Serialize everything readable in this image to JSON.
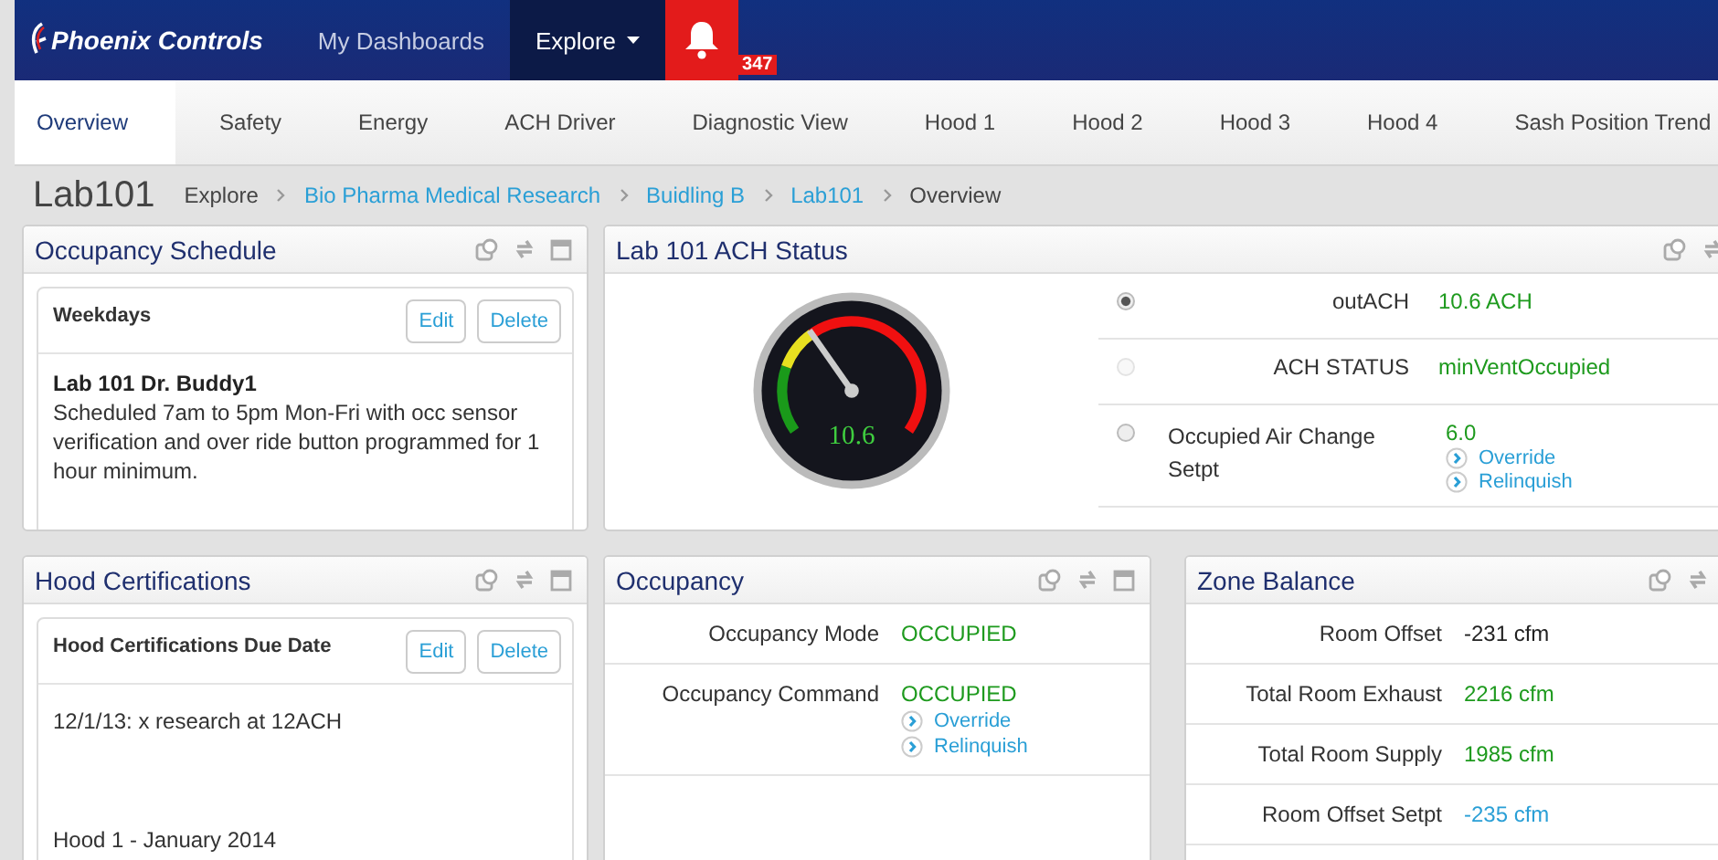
{
  "navbar": {
    "brand": "Phoenix Controls",
    "items": [
      {
        "label": "My Dashboards",
        "selected": false,
        "caret": false
      },
      {
        "label": "Explore",
        "selected": true,
        "caret": true
      }
    ],
    "alerts": {
      "count": "347"
    }
  },
  "tabs": [
    {
      "label": "Overview",
      "selected": true
    },
    {
      "label": "Safety",
      "selected": false
    },
    {
      "label": "Energy",
      "selected": false
    },
    {
      "label": "ACH Driver",
      "selected": false
    },
    {
      "label": "Diagnostic View",
      "selected": false
    },
    {
      "label": "Hood 1",
      "selected": false
    },
    {
      "label": "Hood 2",
      "selected": false
    },
    {
      "label": "Hood 3",
      "selected": false
    },
    {
      "label": "Hood 4",
      "selected": false
    },
    {
      "label": "Sash Position Trend",
      "selected": false
    }
  ],
  "page_title": "Lab101",
  "breadcrumb": [
    {
      "label": "Explore",
      "link": false
    },
    {
      "label": "Bio Pharma Medical Research",
      "link": true
    },
    {
      "label": "Buidling B",
      "link": true
    },
    {
      "label": "Lab101",
      "link": true
    },
    {
      "label": "Overview",
      "link": false
    }
  ],
  "occupancy_schedule": {
    "title": "Occupancy Schedule",
    "card_title": "Weekdays",
    "buttons": [
      "Edit",
      "Delete"
    ],
    "heading": "Lab 101 Dr. Buddy1",
    "body": "Scheduled 7am to 5pm Mon-Fri with occ sensor verification and over ride button programmed for 1 hour minimum."
  },
  "ach_status": {
    "title": "Lab 101 ACH Status",
    "gauge": {
      "reading": "10.6"
    },
    "rows": [
      {
        "label": "outACH",
        "value": "10.6 ACH",
        "selected": true,
        "disabled": false,
        "actions": []
      },
      {
        "label": "ACH STATUS",
        "value": "minVentOccupied",
        "selected": false,
        "disabled": true,
        "actions": []
      },
      {
        "label": "Occupied Air Change Setpt",
        "value": "6.0",
        "selected": false,
        "disabled": false,
        "actions": [
          "Override",
          "Relinquish"
        ]
      }
    ]
  },
  "hood_certifications": {
    "title": "Hood Certifications",
    "card_title": "Hood Certifications Due Date",
    "buttons": [
      "Edit",
      "Delete"
    ],
    "lines": [
      "12/1/13: x research at 12ACH",
      "Hood 1 - January 2014"
    ]
  },
  "occupancy": {
    "title": "Occupancy",
    "rows": [
      {
        "label": "Occupancy Mode",
        "value": "OCCUPIED",
        "kind": "ok",
        "actions": []
      },
      {
        "label": "Occupancy Command",
        "value": "OCCUPIED",
        "kind": "ok",
        "actions": [
          "Override",
          "Relinquish"
        ]
      }
    ]
  },
  "zone_balance": {
    "title": "Zone Balance",
    "rows": [
      {
        "label": "Room Offset",
        "value": "-231 cfm",
        "kind": "plain",
        "actions": []
      },
      {
        "label": "Total Room Exhaust",
        "value": "2216 cfm",
        "kind": "ok",
        "actions": []
      },
      {
        "label": "Total Room Supply",
        "value": "1985 cfm",
        "kind": "ok",
        "actions": []
      },
      {
        "label": "Room Offset Setpt",
        "value": "-235 cfm",
        "kind": "link",
        "actions": []
      }
    ]
  }
}
